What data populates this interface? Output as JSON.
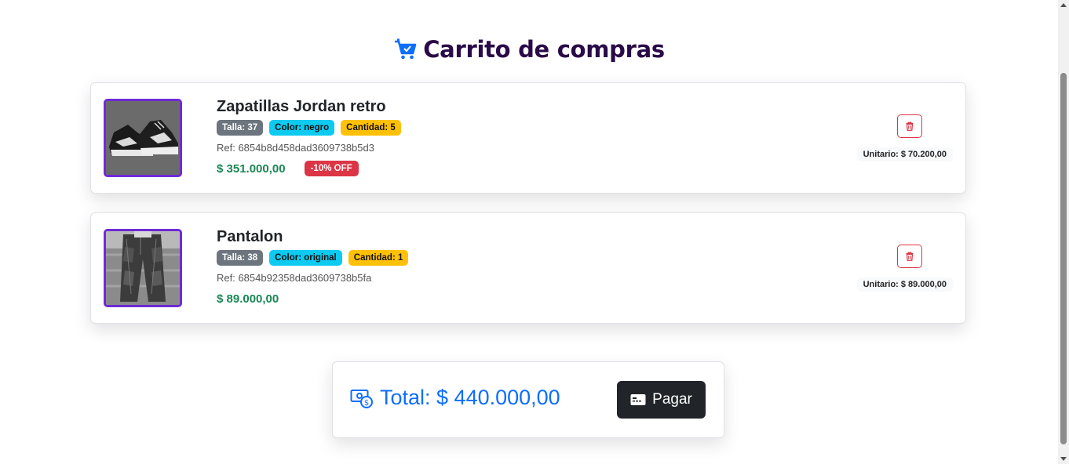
{
  "header": {
    "title": "Carrito de compras",
    "icon": "cart-check-icon"
  },
  "items": [
    {
      "name": "Zapatillas Jordan retro",
      "size": "Talla: 37",
      "color": "Color: negro",
      "quantity": "Cantidad: 5",
      "ref": "Ref: 6854b8d458dad3609738b5d3",
      "price": "$ 351.000,00",
      "discount": "-10% OFF",
      "unit_price": "Unitario: $ 70.200,00",
      "image": "sneaker-image"
    },
    {
      "name": "Pantalon",
      "size": "Talla: 38",
      "color": "Color: original",
      "quantity": "Cantidad: 1",
      "ref": "Ref: 6854b92358dad3609738b5fa",
      "price": "$ 89.000,00",
      "unit_price": "Unitario: $ 89.000,00",
      "image": "pants-image"
    }
  ],
  "summary": {
    "total": "Total: $ 440.000,00",
    "pay_label": "Pagar"
  },
  "colors": {
    "title": "#2a0a48",
    "accent": "#0d6efd",
    "price": "#198754",
    "danger": "#dc3545",
    "thumb_border": "#6f2ad8"
  }
}
